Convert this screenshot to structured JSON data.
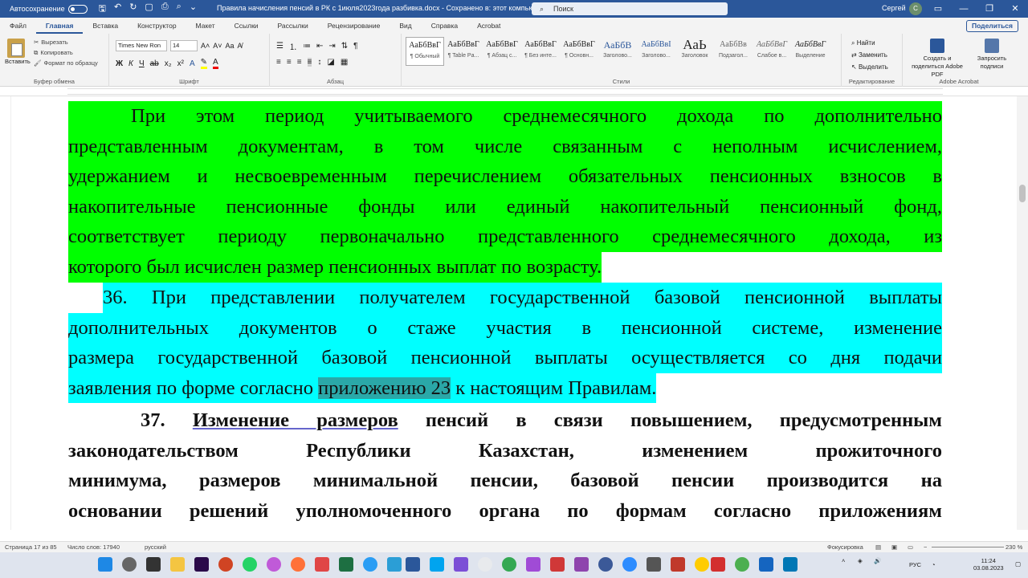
{
  "titlebar": {
    "autosave_label": "Автосохранение",
    "doc_title": "Правила начисления пенсий в РК с 1июля2023года разбивка.docx  -  Сохранено в: этот компьютер",
    "search_placeholder": "Поиск",
    "user_name": "Сергей",
    "avatar_initial": "С"
  },
  "tabs": [
    "Файл",
    "Главная",
    "Вставка",
    "Конструктор",
    "Макет",
    "Ссылки",
    "Рассылки",
    "Рецензирование",
    "Вид",
    "Справка",
    "Acrobat"
  ],
  "share_label": "Поделиться",
  "ribbon": {
    "clipboard": {
      "paste": "Вставить",
      "cut": "Вырезать",
      "copy": "Копировать",
      "format_painter": "Формат по образцу",
      "group": "Буфер обмена"
    },
    "font": {
      "name": "Times New Ron",
      "size": "14",
      "group": "Шрифт"
    },
    "paragraph_group": "Абзац",
    "styles": [
      {
        "preview": "АаБбВвГ",
        "name": "¶ Обычный"
      },
      {
        "preview": "АаБбВвГ",
        "name": "¶ Table Pa..."
      },
      {
        "preview": "АаБбВвГ",
        "name": "¶ Абзац с..."
      },
      {
        "preview": "АаБбВвГ",
        "name": "¶ Без инте..."
      },
      {
        "preview": "АаБбВвГ",
        "name": "¶ Основн..."
      },
      {
        "preview": "АаБбВ",
        "name": "Заголово..."
      },
      {
        "preview": "АаБбВвІ",
        "name": "Заголово..."
      },
      {
        "preview": "АаЬ",
        "name": "Заголовок"
      },
      {
        "preview": "АаБбВв",
        "name": "Подзагол..."
      },
      {
        "preview": "АаБбВвГ",
        "name": "Слабое в..."
      },
      {
        "preview": "АаБбВвГ",
        "name": "Выделение"
      }
    ],
    "styles_group": "Стили",
    "editing": {
      "find": "Найти",
      "replace": "Заменить",
      "select": "Выделить",
      "group": "Редактирование"
    },
    "acrobat": {
      "create": "Создать и поделиться Adobe PDF",
      "request": "Запросить подписи",
      "group": "Adobe Acrobat"
    }
  },
  "document": {
    "p1_lines": [
      "При этом период учитываемого среднемесячного дохода по дополнительно",
      "представленным документам, в том числе связанным с неполным исчислением,",
      "удержанием и несвоевременным перечислением обязательных пенсионных взносов в",
      "накопительные пенсионные фонды или единый накопительный пенсионный фонд,",
      "соответствует периоду первоначально представленного среднемесячного дохода, из",
      "которого был исчислен размер пенсионных выплат по возрасту."
    ],
    "p2_lines": [
      "36. При представлении получателем государственной базовой пенсионной выплаты",
      "дополнительных документов о стаже участия в пенсионной системе, изменение",
      "размера государственной базовой пенсионной выплаты осуществляется со дня подачи"
    ],
    "p2_last_a": "заявления по форме согласно ",
    "p2_last_sel": "приложению 23",
    "p2_last_b": " к настоящим Правилам.",
    "p3_num": "37. ",
    "p3_ul": "Изменение размеров",
    "p3_first_rest": " пенсий в связи повышением, предусмотренным",
    "p3_lines": [
      "законодательством Республики Казахстан, изменением прожиточного",
      "минимума, размеров минимальной пенсии, базовой пенсии производится на",
      "основании решений уполномоченного органа по формам согласно приложениям"
    ]
  },
  "status": {
    "page": "Страница 17 из 85",
    "words": "Число слов: 17940",
    "lang": "русский",
    "focus": "Фокусировка",
    "zoom": "230 %"
  },
  "taskbar": {
    "lang": "РУС",
    "time": "11:24",
    "date": "03.08.2023"
  },
  "colors": {
    "word_blue": "#2b579a",
    "green_hl": "#00ff00",
    "cyan_hl": "#00ffff"
  }
}
